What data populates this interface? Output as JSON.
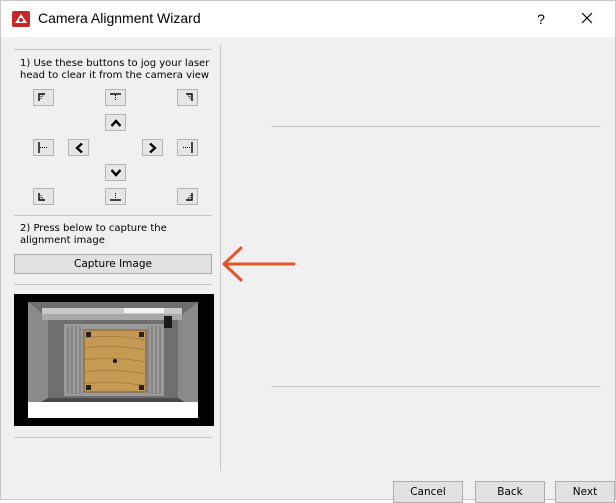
{
  "window": {
    "title": "Camera Alignment Wizard",
    "help_label": "?",
    "icons": {
      "app": "laser-app-icon",
      "close": "close-icon"
    }
  },
  "left_panel": {
    "step1_text": "1) Use these buttons to jog your laser head to clear it from the camera view",
    "jog_buttons": [
      {
        "name": "jog-top-left",
        "icon": "corner-top-left-icon"
      },
      {
        "name": "jog-top-center",
        "icon": "edge-top-icon"
      },
      {
        "name": "jog-top-right",
        "icon": "corner-top-right-icon"
      },
      {
        "name": "jog-up",
        "icon": "chevron-up-icon"
      },
      {
        "name": "jog-middle-left",
        "icon": "edge-left-icon"
      },
      {
        "name": "jog-left",
        "icon": "chevron-left-icon"
      },
      {
        "name": "jog-right",
        "icon": "chevron-right-icon"
      },
      {
        "name": "jog-middle-right",
        "icon": "edge-right-icon"
      },
      {
        "name": "jog-down",
        "icon": "chevron-down-icon"
      },
      {
        "name": "jog-bottom-left",
        "icon": "corner-bottom-left-icon"
      },
      {
        "name": "jog-bottom-center",
        "icon": "edge-bottom-icon"
      },
      {
        "name": "jog-bottom-right",
        "icon": "corner-bottom-right-icon"
      }
    ],
    "step2_text": "2) Press below to capture the alignment image",
    "capture_label": "Capture Image"
  },
  "footer": {
    "cancel_label": "Cancel",
    "back_label": "Back",
    "next_label": "Next"
  },
  "colors": {
    "window_bg": "#f0f0f0",
    "button_bg": "#e1e1e1",
    "annotation_arrow": "#e0552a",
    "brand_red": "#c62828"
  }
}
